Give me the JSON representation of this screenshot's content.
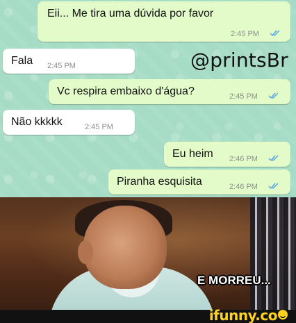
{
  "chat": {
    "messages": [
      {
        "direction": "outgoing",
        "text": "Eii... Me tira uma dúvida por favor",
        "time": "2:45 PM",
        "read": true
      },
      {
        "direction": "incoming",
        "text": "Fala",
        "time": "2:45 PM"
      },
      {
        "direction": "outgoing",
        "text": "Vc respira embaixo d'água?",
        "time": "2:45 PM",
        "read": true
      },
      {
        "direction": "incoming",
        "text": "Não kkkkk",
        "time": "2:45 PM"
      },
      {
        "direction": "outgoing",
        "text": "Eu heim",
        "time": "2:46 PM",
        "read": true
      },
      {
        "direction": "outgoing",
        "text": "Piranha esquisita",
        "time": "2:46 PM",
        "read": true
      }
    ],
    "watermark": "@printsBr",
    "read_tick_color": "#4fa3e0"
  },
  "meme": {
    "caption": "E MORREU..."
  },
  "footer": {
    "brand": "ifunny.co",
    "brand_color": "#ffd21f"
  }
}
